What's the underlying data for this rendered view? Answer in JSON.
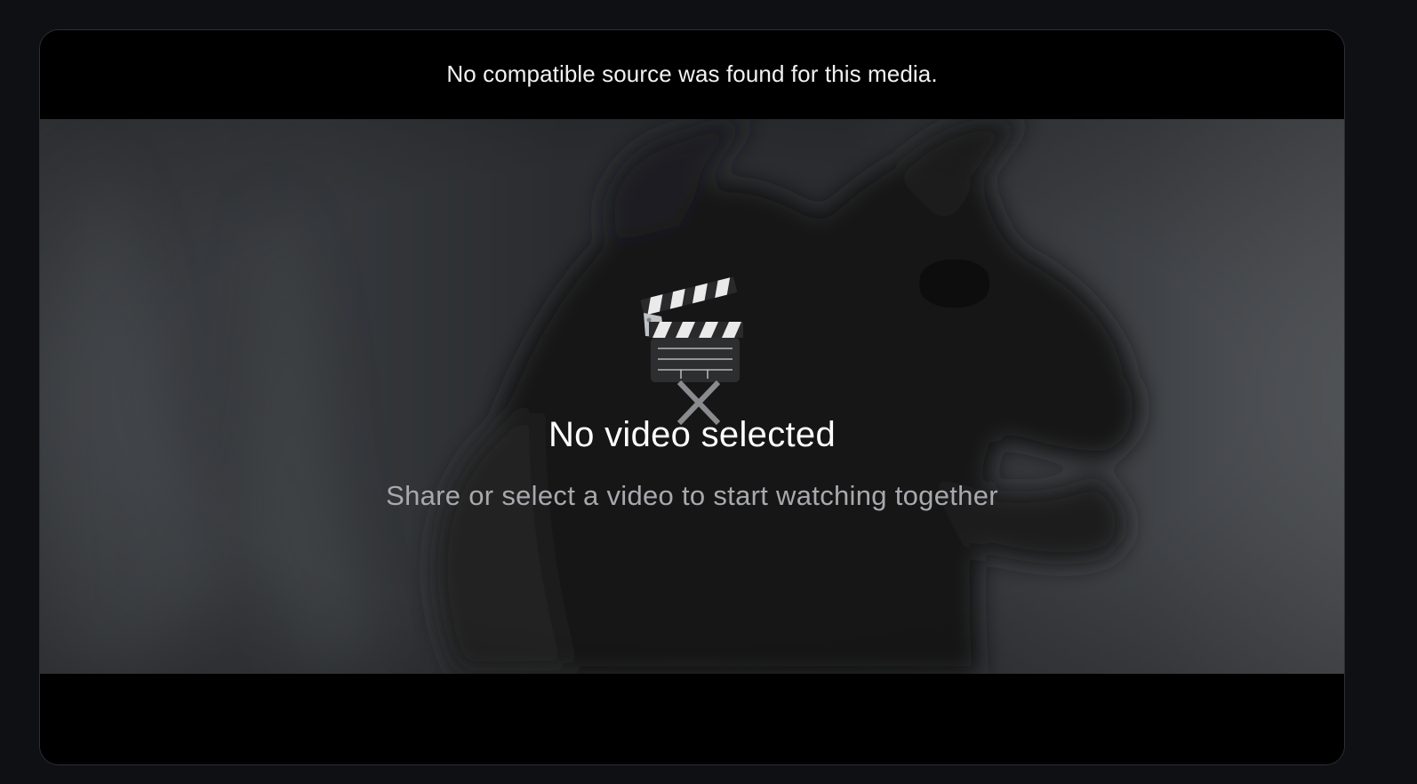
{
  "player": {
    "error_message": "No compatible source was found for this media."
  },
  "placeholder": {
    "icon": "clapper-board-icon",
    "title": "No video selected",
    "subtitle": "Share or select a video to start watching together"
  },
  "colors": {
    "page_background": "#0f1013",
    "player_background": "#000000",
    "title_text": "#ffffff",
    "subtitle_text": "#a7a9ad"
  }
}
